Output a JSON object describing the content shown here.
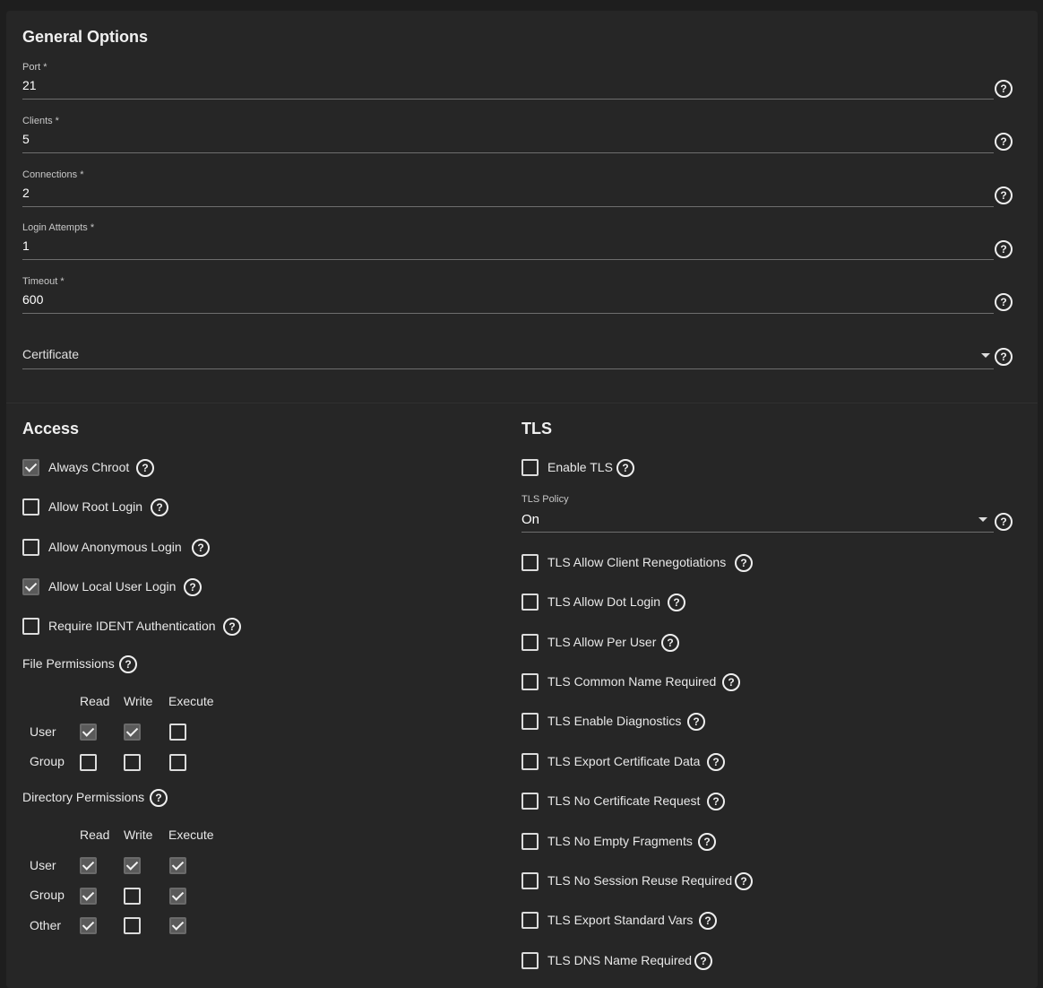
{
  "general": {
    "title": "General Options",
    "port": {
      "label": "Port *",
      "value": "21"
    },
    "clients": {
      "label": "Clients *",
      "value": "5"
    },
    "connections": {
      "label": "Connections *",
      "value": "2"
    },
    "login_attempts": {
      "label": "Login Attempts *",
      "value": "1"
    },
    "timeout": {
      "label": "Timeout *",
      "value": "600"
    },
    "certificate": {
      "placeholder": "Certificate"
    }
  },
  "access": {
    "title": "Access",
    "items": [
      {
        "label": "Always Chroot",
        "checked": true
      },
      {
        "label": "Allow Root Login",
        "checked": false
      },
      {
        "label": "Allow Anonymous Login",
        "checked": false
      },
      {
        "label": "Allow Local User Login",
        "checked": true
      },
      {
        "label": "Require IDENT Authentication",
        "checked": false
      }
    ],
    "file_permissions": {
      "label": "File Permissions",
      "columns": [
        "Read",
        "Write",
        "Execute"
      ],
      "rows": [
        {
          "label": "User",
          "values": [
            true,
            true,
            false
          ]
        },
        {
          "label": "Group",
          "values": [
            false,
            false,
            false
          ]
        }
      ]
    },
    "directory_permissions": {
      "label": "Directory Permissions",
      "columns": [
        "Read",
        "Write",
        "Execute"
      ],
      "rows": [
        {
          "label": "User",
          "values": [
            true,
            true,
            true
          ]
        },
        {
          "label": "Group",
          "values": [
            true,
            false,
            true
          ]
        },
        {
          "label": "Other",
          "values": [
            true,
            false,
            true
          ]
        }
      ]
    }
  },
  "tls": {
    "title": "TLS",
    "enable_tls": {
      "label": "Enable TLS",
      "checked": false
    },
    "policy": {
      "label": "TLS Policy",
      "value": "On"
    },
    "items": [
      {
        "label": "TLS Allow Client Renegotiations",
        "checked": false
      },
      {
        "label": "TLS Allow Dot Login",
        "checked": false
      },
      {
        "label": "TLS Allow Per User",
        "checked": false
      },
      {
        "label": "TLS Common Name Required",
        "checked": false
      },
      {
        "label": "TLS Enable Diagnostics",
        "checked": false
      },
      {
        "label": "TLS Export Certificate Data",
        "checked": false
      },
      {
        "label": "TLS No Certificate Request",
        "checked": false
      },
      {
        "label": "TLS No Empty Fragments",
        "checked": false
      },
      {
        "label": "TLS No Session Reuse Required",
        "checked": false
      },
      {
        "label": "TLS Export Standard Vars",
        "checked": false
      },
      {
        "label": "TLS DNS Name Required",
        "checked": false
      }
    ]
  }
}
